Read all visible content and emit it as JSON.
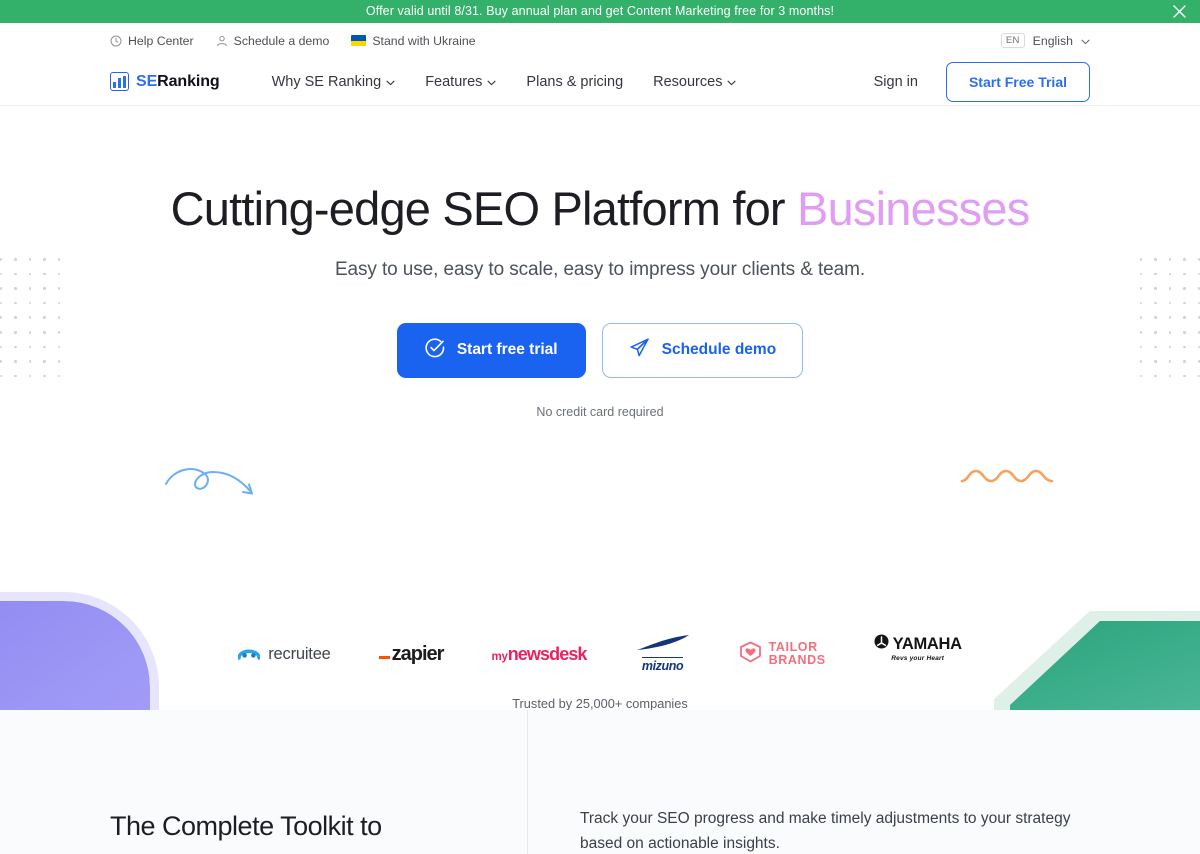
{
  "promo": {
    "text": "Offer valid until 8/31. Buy annual plan and get Content Marketing free for 3 months!",
    "close_label": "×",
    "bg_color": "#33b06a"
  },
  "utility_bar": {
    "items": [
      {
        "label": "Help Center",
        "icon": "clock-icon"
      },
      {
        "label": "Schedule a demo",
        "icon": "person-icon"
      },
      {
        "label": "Stand with Ukraine",
        "icon": "ukraine-flag-icon"
      }
    ],
    "language": {
      "code": "EN",
      "label": "English",
      "caret": "chevron-down-icon"
    }
  },
  "nav": {
    "logo": {
      "se": "SE",
      "ranking": "Ranking",
      "icon": "bar-chart-icon"
    },
    "links": [
      {
        "label": "Why SE Ranking",
        "has_caret": true
      },
      {
        "label": "Features",
        "has_caret": true
      },
      {
        "label": "Plans & pricing",
        "has_caret": false
      },
      {
        "label": "Resources",
        "has_caret": true
      }
    ],
    "sign_in": "Sign in",
    "cta": "Start Free Trial",
    "accent_color": "#2c6ef2"
  },
  "hero": {
    "title_main": "Cutting-edge SEO Platform for ",
    "title_accent": "Businesses",
    "accent_color": "#e09ef2",
    "subtitle": "Easy to use, easy to scale, easy to impress your clients & team.",
    "primary_cta": {
      "label": "Start free trial",
      "icon": "check-circle-icon",
      "bg": "#1a62f0"
    },
    "secondary_cta": {
      "label": "Schedule demo",
      "icon": "paper-plane-icon"
    },
    "note": "No credit card required",
    "decor": {
      "left_arrow": "curly-arrow-icon",
      "left_arrow_color": "#62a9f0",
      "right_wave": "wave-squiggle-icon",
      "right_wave_color": "#f09a58"
    }
  },
  "clients": {
    "trusted_text": "Trusted by 25,000+ companies",
    "logos": [
      {
        "name": "recruitee",
        "text": "recruitee"
      },
      {
        "name": "zapier",
        "text": "zapier"
      },
      {
        "name": "mynewsdesk",
        "prefix": "my",
        "text": "newsdesk"
      },
      {
        "name": "mizuno",
        "text": "mizuno"
      },
      {
        "name": "tailor-brands",
        "line1": "TAILOR",
        "line2": "BRANDS"
      },
      {
        "name": "yamaha",
        "text": "YAMAHA",
        "tagline": "Revs your Heart"
      }
    ]
  },
  "section_two": {
    "title": "The Complete Toolkit to",
    "body": "Track your SEO progress and make timely adjustments to your strategy based on actionable insights."
  }
}
